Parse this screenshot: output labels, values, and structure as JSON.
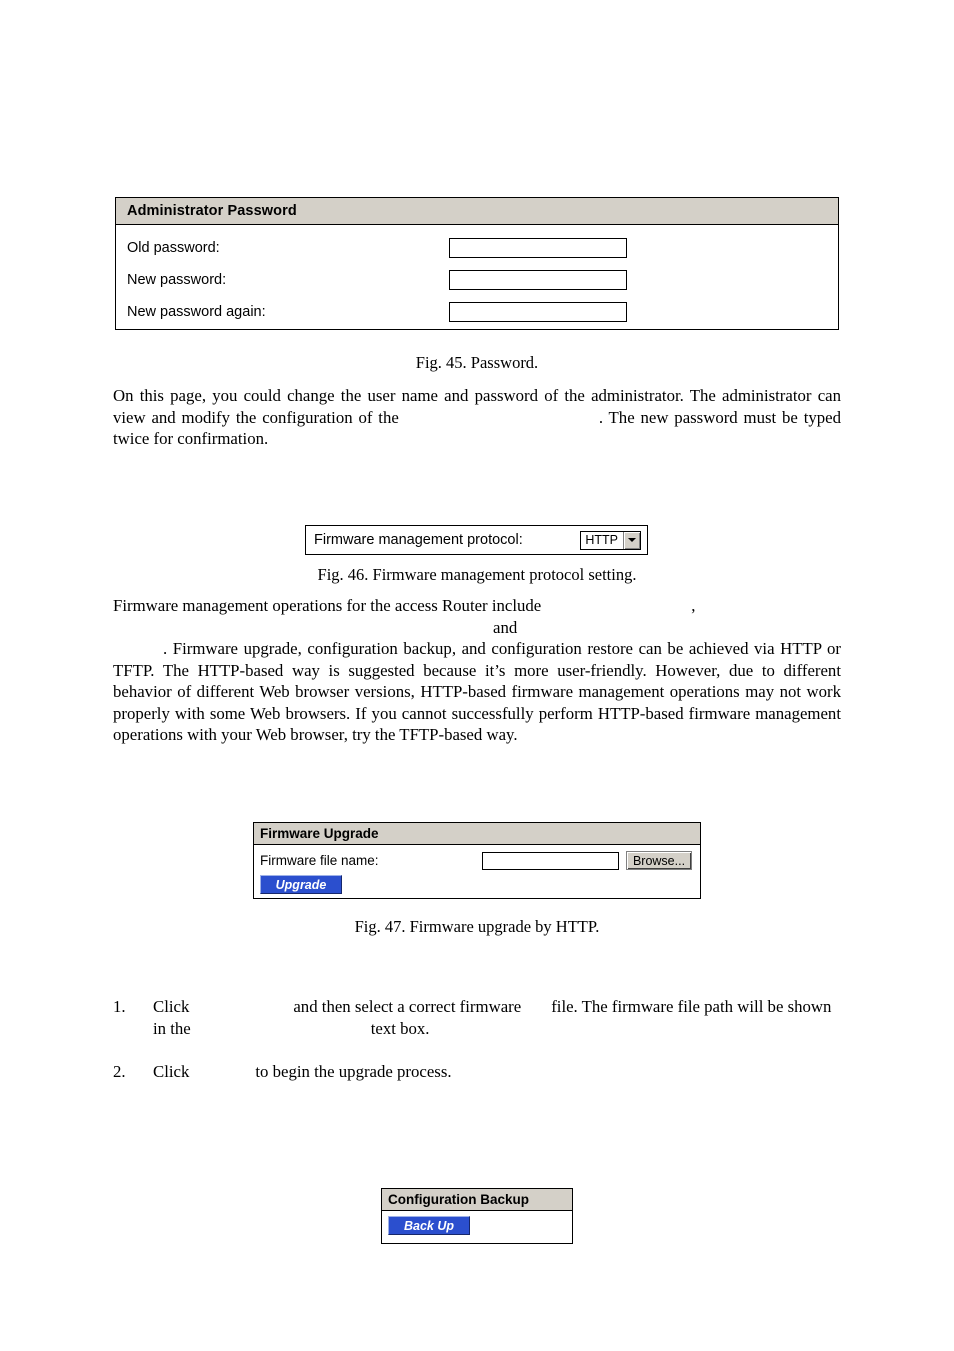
{
  "fig45": {
    "panel_title": "Administrator Password",
    "rows": [
      {
        "label": "Old password:",
        "value": "",
        "placeholder": ""
      },
      {
        "label": "New password:",
        "value": "",
        "placeholder": ""
      },
      {
        "label": "New password again:",
        "value": "",
        "placeholder": ""
      }
    ],
    "caption": "Fig. 45. Password."
  },
  "para1": {
    "line1_a": "On this page, you could change the user name and password of the administrator. The administrator",
    "line2_a": "can view and modify the configuration of the",
    "line2_b": ". The new password must be typed twice",
    "line3": "for confirmation."
  },
  "fig46": {
    "label": "Firmware management protocol:",
    "selected": "HTTP",
    "options": [
      "HTTP"
    ],
    "caption": "Fig. 46. Firmware management protocol setting."
  },
  "para2": {
    "line1_a": "Firmware management operations for the access Router include",
    "line1_b": ",",
    "line2_a": "and",
    "line3_a": ". Firmware upgrade, configuration backup, and configuration restore can be achieved via",
    "line4": "HTTP or TFTP. The HTTP-based way is suggested because it’s more user-friendly. However, due to",
    "line5": "different behavior of different Web browser versions, HTTP-based firmware management operations",
    "line6": "may not work properly with some Web browsers. If you cannot successfully perform HTTP-based",
    "line7": "firmware management operations with your Web browser, try the TFTP-based way."
  },
  "fig47": {
    "panel_title": "Firmware Upgrade",
    "file_label": "Firmware file name:",
    "file_value": "",
    "browse_label": "Browse...",
    "upgrade_label": "Upgrade",
    "caption": "Fig. 47. Firmware upgrade by HTTP."
  },
  "steps": [
    {
      "num": "1.",
      "t1": "Click",
      "t2": "and then select a correct firmware",
      "t3": "file. The firmware file path will be shown",
      "t4": "in the",
      "t5": "text box."
    },
    {
      "num": "2.",
      "t1": "Click",
      "t2": "to begin the upgrade process."
    }
  ],
  "fig48": {
    "panel_title": "Configuration Backup",
    "backup_label": "Back Up"
  }
}
